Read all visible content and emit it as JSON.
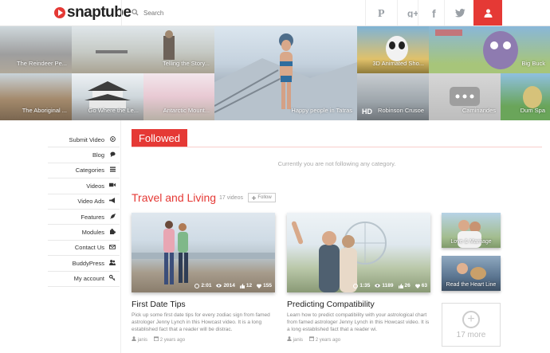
{
  "header": {
    "logo_text": "snaptube",
    "search_placeholder": "Search",
    "social": [
      "pinterest-icon",
      "google-plus-icon",
      "facebook-icon",
      "twitter-icon"
    ],
    "user_icon": "user-icon",
    "accent": "#e53935"
  },
  "mosaic": {
    "row1": [
      "The Reindeer Pe...",
      "Telling the Story...",
      "3D Animated Sho...",
      "Big Buck"
    ],
    "row2": [
      "The Aboriginal ...",
      "Go Where the Le...",
      "Antarctic Mount...",
      "Robinson Crusoe",
      "Caminandes",
      "Dum Spa"
    ],
    "featured": "Happy people in Tatras",
    "hd_badge": "HD"
  },
  "sidebar": {
    "items": [
      {
        "label": "Submit Video",
        "icon": "play-circle-icon"
      },
      {
        "label": "Blog",
        "icon": "chat-icon"
      },
      {
        "label": "Categories",
        "icon": "list-icon"
      },
      {
        "label": "Videos",
        "icon": "video-camera-icon"
      },
      {
        "label": "Video Ads",
        "icon": "megaphone-icon"
      },
      {
        "label": "Features",
        "icon": "rocket-icon"
      },
      {
        "label": "Modules",
        "icon": "puzzle-icon"
      },
      {
        "label": "Contact Us",
        "icon": "envelope-icon"
      },
      {
        "label": "BuddyPress",
        "icon": "users-icon"
      },
      {
        "label": "My account",
        "icon": "key-icon"
      }
    ]
  },
  "followed": {
    "title": "Followed",
    "empty_message": "Currently you are not following any category."
  },
  "section": {
    "title": "Travel and Living",
    "count": "17 videos",
    "follow_label": "Follow",
    "more_label": "17 more"
  },
  "cards": [
    {
      "title": "First Date Tips",
      "description": "Pick up some first date tips for every zodiac sign from famed astrologer Jenny Lynch in this Howcast video. It is a long established fact that a reader will be distrac.",
      "author": "janis",
      "date": "2 years ago",
      "duration": "2:01",
      "views": "2014",
      "likes": "12",
      "hearts": "155"
    },
    {
      "title": "Predicting Compatibility",
      "description": "Learn how to predict compatibility with your astrological chart from famed astrologer Jenny Lynch in this Howcast video. It is a long established fact that a reader wi.",
      "author": "janis",
      "date": "2 years ago",
      "duration": "1:35",
      "views": "1189",
      "likes": "26",
      "hearts": "63"
    }
  ],
  "mini_cards": [
    "Love & Marriage",
    "Read the Heart Line"
  ]
}
